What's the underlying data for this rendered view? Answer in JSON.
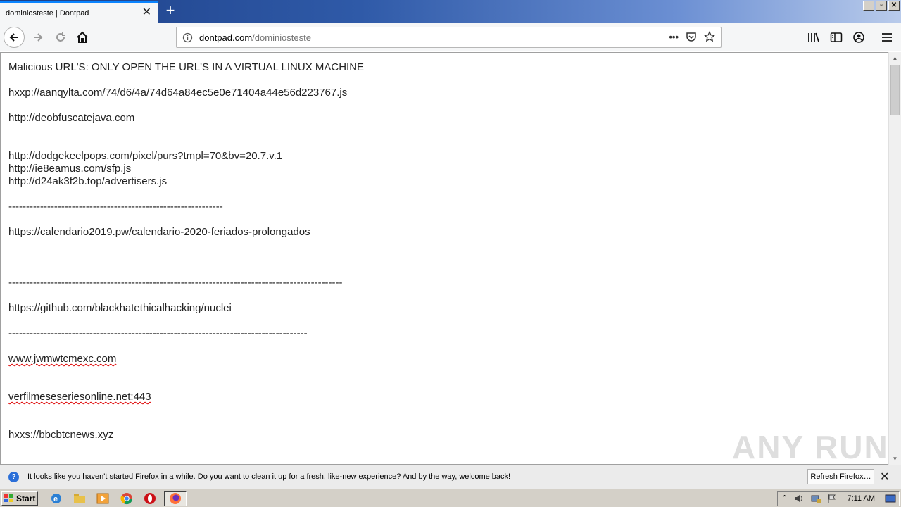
{
  "browser": {
    "tab_title": "dominiosteste | Dontpad",
    "tab_close": "✕",
    "new_tab": "+",
    "url_domain": "dontpad.com",
    "url_path": "/dominiosteste",
    "page_actions": "•••"
  },
  "window": {
    "minimize": "_",
    "restore": "▫",
    "close": "✕"
  },
  "pad": {
    "lines": [
      {
        "text": "Malicious URL'S: ONLY OPEN THE URL'S IN A VIRTUAL LINUX MACHINE"
      },
      {
        "text": "hxxp://aanqylta.com/74/d6/4a/74d64a84ec5e0e71404a44e56d223767.js"
      },
      {
        "text": "http://deobfuscatejava.com"
      },
      {
        "text": "http://dodgekeelpops.com/pixel/purs?tmpl=70&bv=20.7.v.1"
      },
      {
        "text": "http://ie8eamus.com/sfp.js"
      },
      {
        "text": "http://d24ak3f2b.top/advertisers.js"
      },
      {
        "text": "-------------------------------------------------------------"
      },
      {
        "text": "https://calendario2019.pw/calendario-2020-feriados-prolongados"
      },
      {
        "text": "-----------------------------------------------------------------------------------------------"
      },
      {
        "text": "https://github.com/blackhatethicalhacking/nuclei"
      },
      {
        "text": "-------------------------------------------------------------------------------------"
      },
      {
        "text": "www.jwmwtcmexc.com"
      },
      {
        "text": "verfilmeseseriesonline.net:443"
      },
      {
        "text": "hxxs://bbcbtcnews.xyz"
      }
    ]
  },
  "notification": {
    "text": "It looks like you haven't started Firefox in a while. Do you want to clean it up for a fresh, like-new experience? And by the way, welcome back!",
    "button": "Refresh Firefox…",
    "close": "✕"
  },
  "watermark": "ANY RUN",
  "taskbar": {
    "start_label": "Start",
    "clock": "7:11 AM"
  },
  "colors": {
    "accent": "#0a84ff",
    "titlebar": "#2f5aa8",
    "taskbar": "#d4d0c8"
  }
}
